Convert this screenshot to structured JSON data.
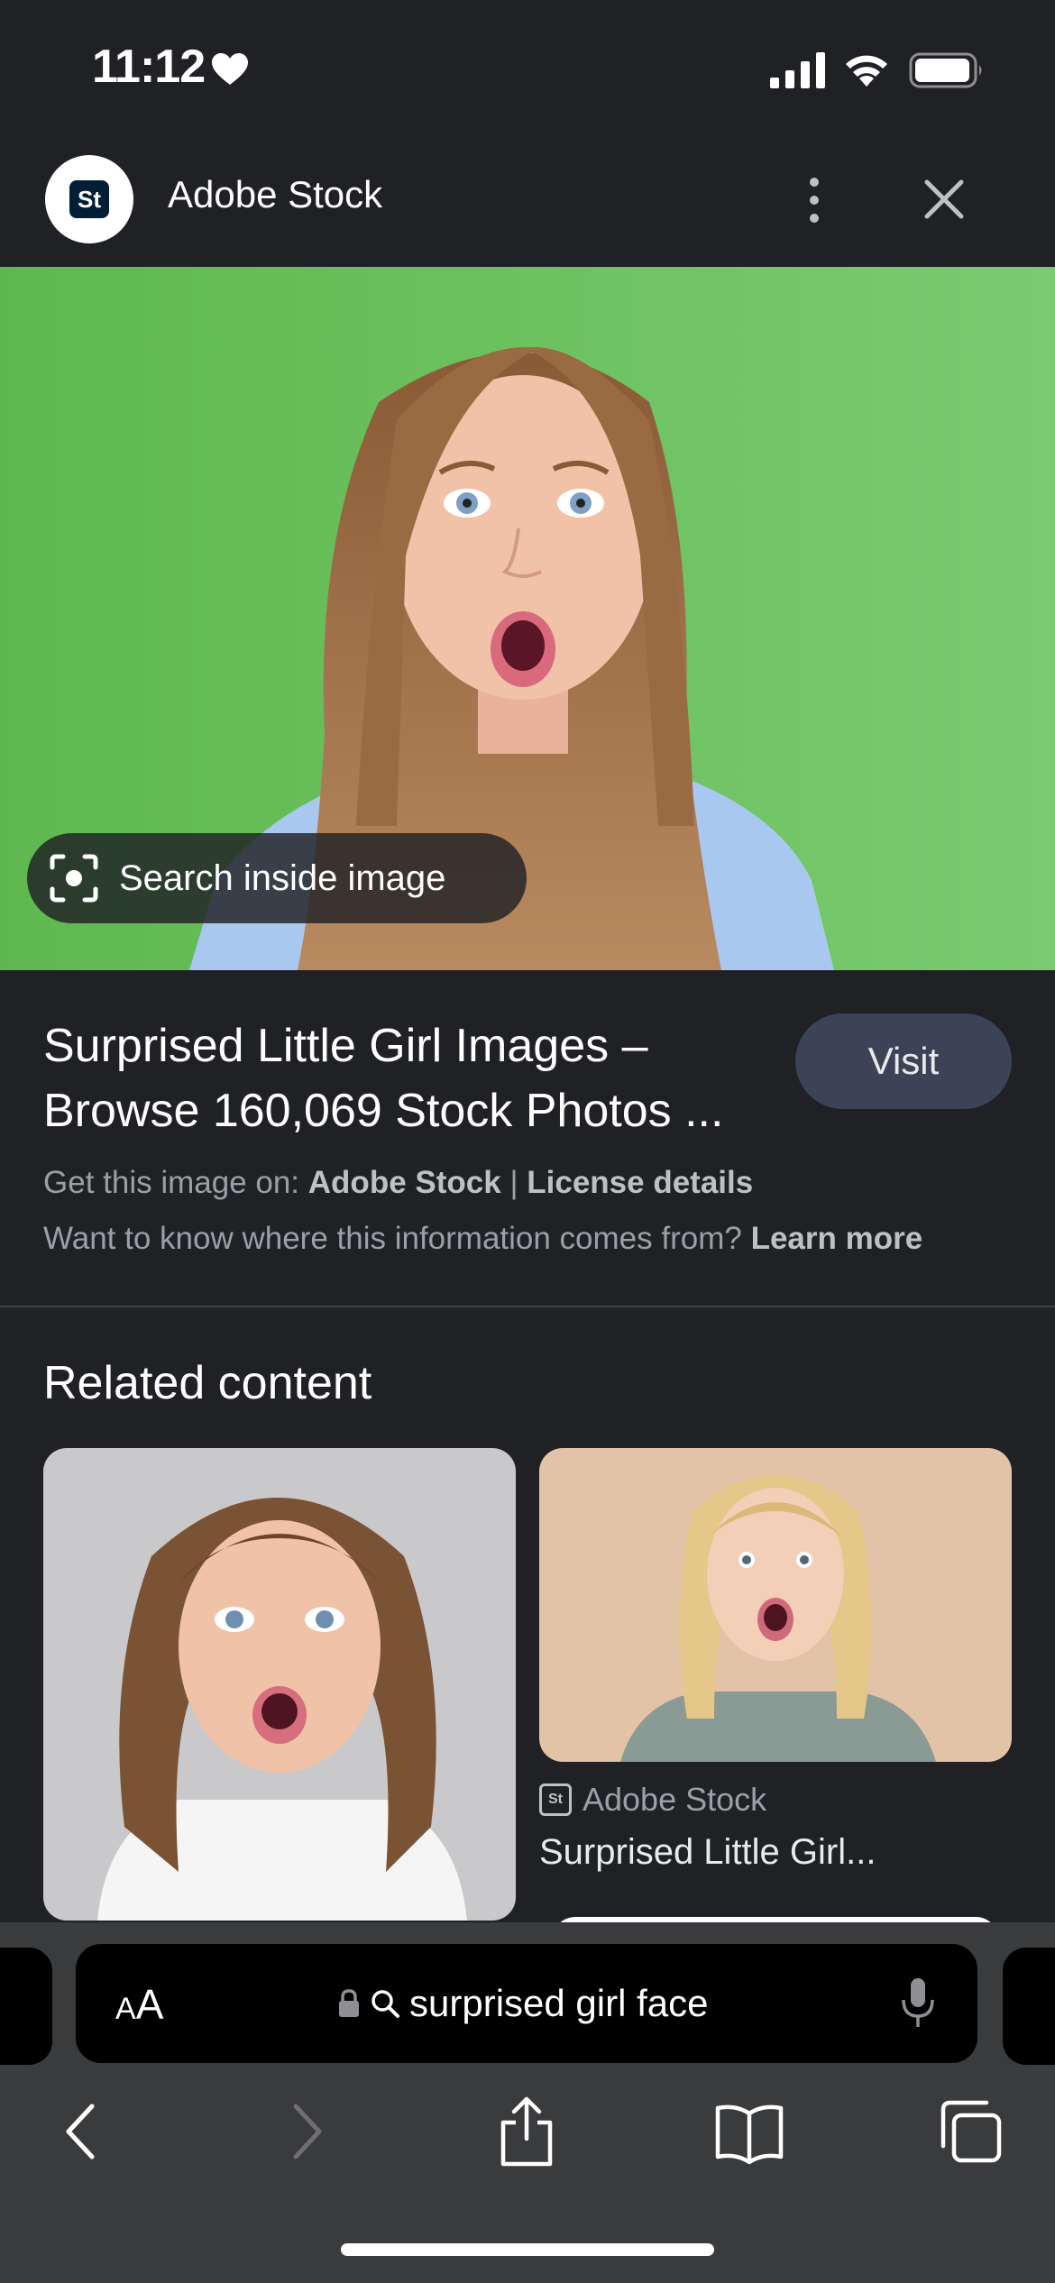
{
  "status_bar": {
    "time": "11:12"
  },
  "header": {
    "logo_text": "St",
    "site_name": "Adobe Stock"
  },
  "hero": {
    "search_inside_label": "Search inside image"
  },
  "result": {
    "title": "Surprised Little Girl Images – Browse 160,069 Stock Photos ...",
    "visit_label": "Visit",
    "get_image_prefix": "Get this image on:",
    "source_name": "Adobe Stock",
    "separator": "|",
    "license_label": "License details",
    "info_question": "Want to know where this information comes from?",
    "learn_more_label": "Learn more"
  },
  "related": {
    "heading": "Related content",
    "card2": {
      "source_icon_text": "St",
      "source_name": "Adobe Stock",
      "title": "Surprised Little Girl..."
    }
  },
  "browser": {
    "text_size_small": "A",
    "text_size_big": "A",
    "address": "surprised girl face"
  },
  "colors": {
    "background": "#202124",
    "visit_button": "#3c4356",
    "hero_green": "#6cc25e",
    "toolbar": "#3a3b3d"
  },
  "icons": [
    "heart-icon",
    "signal-icon",
    "wifi-icon",
    "battery-icon",
    "more-vert-icon",
    "close-icon",
    "lens-icon",
    "lock-icon",
    "search-icon",
    "mic-icon",
    "back-icon",
    "forward-icon",
    "share-icon",
    "bookmarks-icon",
    "tabs-icon"
  ]
}
